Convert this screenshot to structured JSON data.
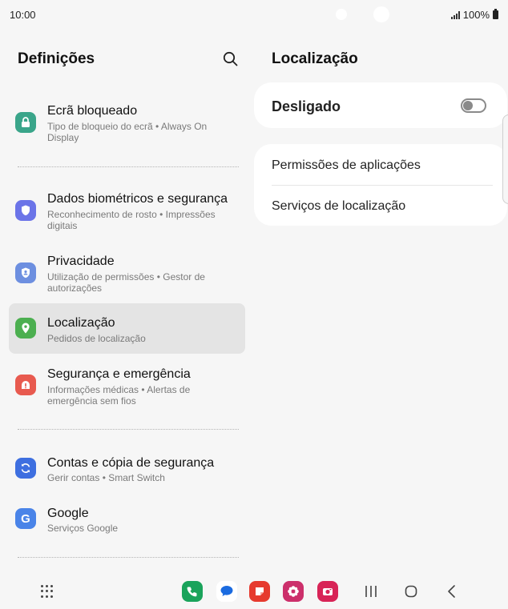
{
  "status_bar": {
    "time": "10:00",
    "battery": "100%"
  },
  "left_pane": {
    "title": "Definições",
    "items": [
      {
        "title": "Ecrã bloqueado",
        "subtitle": "Tipo de bloqueio do ecrã  •  Always On Display",
        "icon": "lock-icon",
        "color": "#3aa58a"
      },
      {
        "title": "Dados biométricos e segurança",
        "subtitle": "Reconhecimento de rosto  •  Impressões digitais",
        "icon": "shield-icon",
        "color": "#6b74e8"
      },
      {
        "title": "Privacidade",
        "subtitle": "Utilização de permissões  •  Gestor de autorizações",
        "icon": "privacy-shield-icon",
        "color": "#6d8fe0"
      },
      {
        "title": "Localização",
        "subtitle": "Pedidos de localização",
        "icon": "location-pin-icon",
        "color": "#4caf50"
      },
      {
        "title": "Segurança e emergência",
        "subtitle": "Informações médicas  •  Alertas de emergência sem fios",
        "icon": "emergency-icon",
        "color": "#e85a4f"
      },
      {
        "title": "Contas e cópia de segurança",
        "subtitle": "Gerir contas  •  Smart Switch",
        "icon": "sync-icon",
        "color": "#3e6fe0"
      },
      {
        "title": "Google",
        "subtitle": "Serviços Google",
        "icon": "google-icon",
        "color": "#4a84e8"
      }
    ]
  },
  "right_pane": {
    "title": "Localização",
    "master_switch": {
      "label": "Desligado",
      "on": false
    },
    "rows": [
      "Permissões de aplicações",
      "Serviços de localização"
    ]
  },
  "dock": {
    "apps": [
      {
        "name": "phone-app-icon",
        "color": "#1aa35b"
      },
      {
        "name": "messages-app-icon",
        "color": "#1b6be0"
      },
      {
        "name": "notes-app-icon",
        "color": "#e63a2e"
      },
      {
        "name": "gallery-app-icon",
        "color": "#cc2f6b"
      },
      {
        "name": "camera-app-icon",
        "color": "#d82457"
      }
    ]
  }
}
